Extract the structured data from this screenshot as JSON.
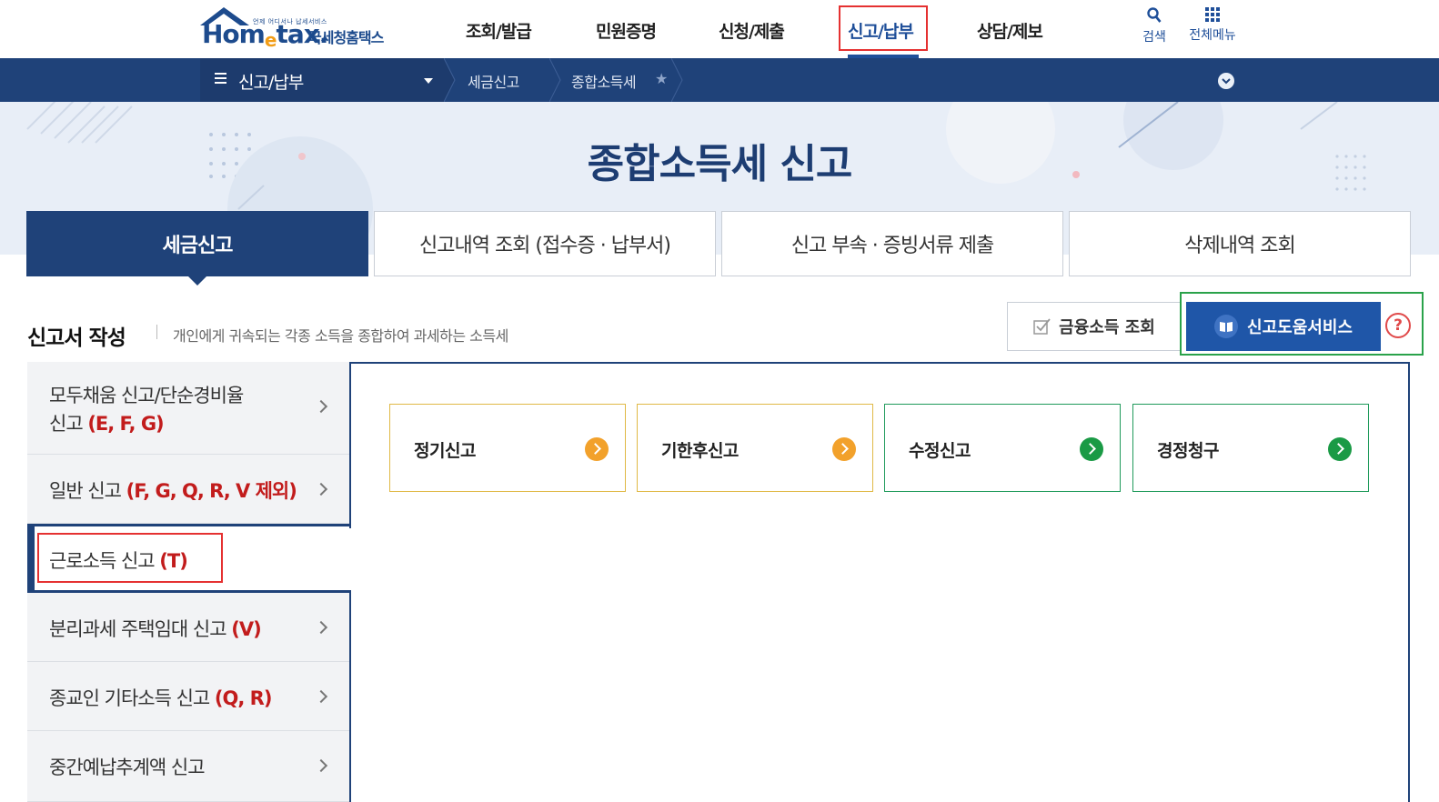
{
  "header": {
    "logo_sub": "언제 어디서나 납세서비스",
    "logo_main_a": "Hom",
    "logo_main_e": "e",
    "logo_main_b": "tax.",
    "logo_kor": "국세청홈택스",
    "gnb": [
      {
        "label": "조회/발급"
      },
      {
        "label": "민원증명"
      },
      {
        "label": "신청/제출"
      },
      {
        "label": "신고/납부",
        "active": true
      },
      {
        "label": "상담/제보"
      }
    ],
    "search_label": "검색",
    "menu_label": "전체메뉴"
  },
  "breadcrumb": {
    "menu_label": "신고/납부",
    "items": [
      "세금신고",
      "종합소득세"
    ]
  },
  "hero": {
    "title": "종합소득세 신고"
  },
  "tabs": [
    {
      "label": "세금신고",
      "active": true
    },
    {
      "label": "신고내역 조회 (접수증 · 납부서)"
    },
    {
      "label": "신고 부속 · 증빙서류 제출"
    },
    {
      "label": "삭제내역 조회"
    }
  ],
  "section": {
    "title": "신고서 작성",
    "description": "개인에게 귀속되는 각종 소득을 종합하여 과세하는 소득세"
  },
  "buttons": {
    "financial_income": "금융소득 조회",
    "help_service": "신고도움서비스",
    "help_q": "?"
  },
  "side_menu": [
    {
      "line1": "모두채움 신고/단순경비율",
      "line2_plain": "신고 ",
      "line2_red": "(E, F, G)"
    },
    {
      "plain": "일반 신고 ",
      "red": "(F, G, Q, R, V 제외)"
    },
    {
      "plain": "근로소득 신고 ",
      "red": "(T)",
      "active": true
    },
    {
      "plain": "분리과세 주택임대 신고 ",
      "red": "(V)"
    },
    {
      "plain": "종교인 기타소득 신고 ",
      "red": "(Q, R)"
    },
    {
      "plain": "중간예납추계액 신고",
      "red": ""
    }
  ],
  "cards": [
    {
      "label": "정기신고",
      "color": "#f2a12b"
    },
    {
      "label": "기한후신고",
      "color": "#f2a12b"
    },
    {
      "label": "수정신고",
      "color": "#1a9a45"
    },
    {
      "label": "경정청구",
      "color": "#1a9a45"
    }
  ],
  "colors": {
    "primary_navy": "#1f4279",
    "highlight_red": "#e53131",
    "highlight_green": "#2aa24a",
    "hero_bg": "#e8eef7"
  }
}
